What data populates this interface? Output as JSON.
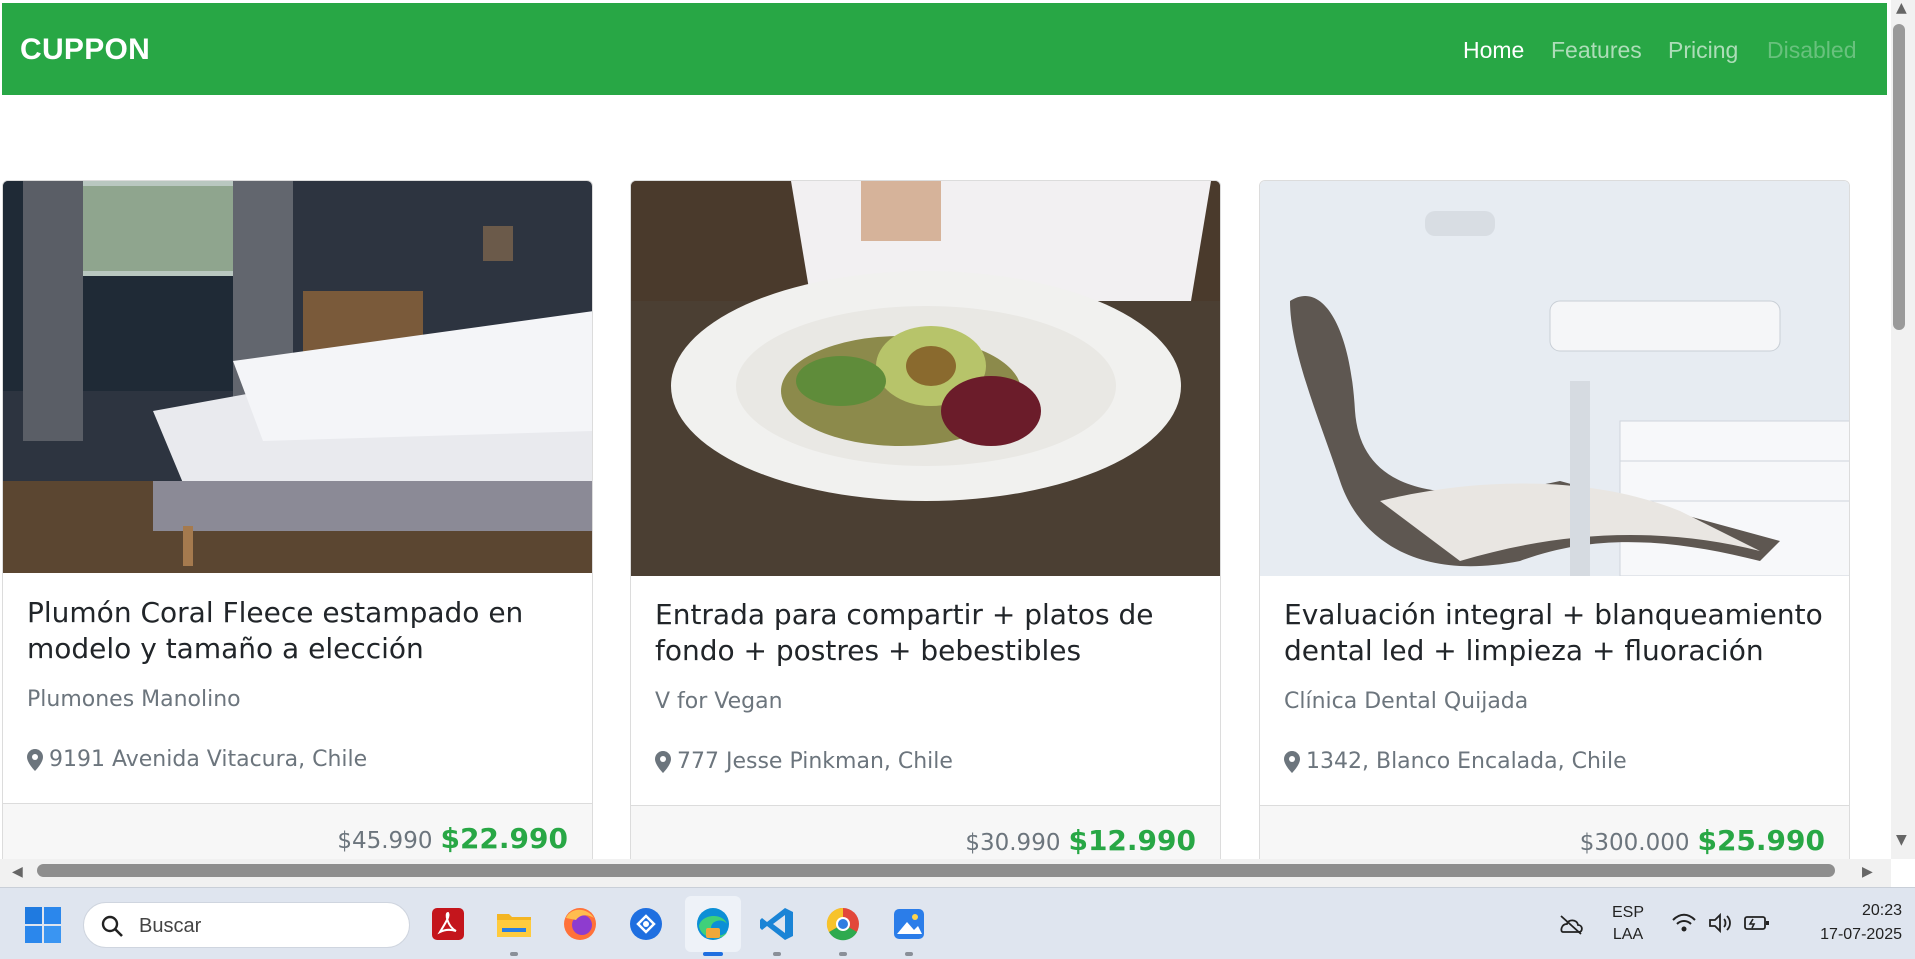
{
  "navbar": {
    "brand": "CUPPON",
    "links": [
      {
        "label": "Home"
      },
      {
        "label": "Features"
      },
      {
        "label": "Pricing"
      },
      {
        "label": "Disabled"
      }
    ]
  },
  "cards": [
    {
      "title": "Plumón Coral Fleece estampado en modelo y tamaño a elección",
      "merchant": "Plumones Manolino",
      "location": "9191 Avenida Vitacura, Chile",
      "old_price": "$45.990",
      "new_price": "$22.990",
      "image": "bedroom-photo"
    },
    {
      "title": "Entrada para compartir + platos de fondo + postres + bebestibles",
      "merchant": "V for Vegan",
      "location": "777 Jesse Pinkman, Chile",
      "old_price": "$30.990",
      "new_price": "$12.990",
      "image": "vegan-dish-photo"
    },
    {
      "title": "Evaluación integral + blanqueamiento dental led + limpieza + fluoración",
      "merchant": "Clínica Dental Quijada",
      "location": "1342, Blanco Encalada, Chile",
      "old_price": "$300.000",
      "new_price": "$25.990",
      "image": "dental-chair-photo"
    }
  ],
  "taskbar": {
    "search_placeholder": "Buscar",
    "language": "ESP",
    "layout": "LAA",
    "time": "20:23",
    "date": "17-07-2025",
    "apps": [
      "start-icon",
      "acrobat-icon",
      "file-explorer-icon",
      "firefox-icon",
      "copilot-icon",
      "edge-icon",
      "vscode-icon",
      "chrome-icon",
      "photos-icon"
    ]
  },
  "colors": {
    "brand_green": "#28a745",
    "muted_text": "#6c757d"
  }
}
